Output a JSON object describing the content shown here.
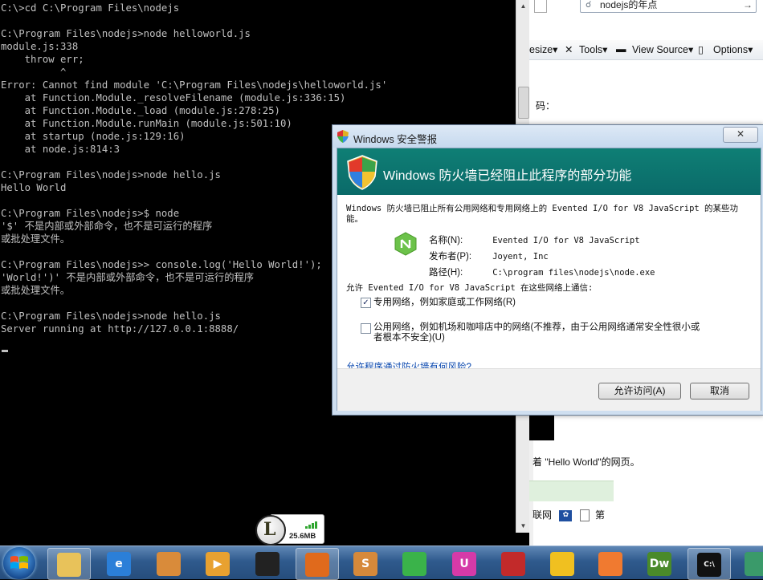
{
  "console": {
    "lines": [
      "C:\\>cd C:\\Program Files\\nodejs",
      "",
      "C:\\Program Files\\nodejs>node helloworld.js",
      "module.js:338",
      "    throw err;",
      "          ^",
      "Error: Cannot find module 'C:\\Program Files\\nodejs\\helloworld.js'",
      "    at Function.Module._resolveFilename (module.js:336:15)",
      "    at Function.Module._load (module.js:278:25)",
      "    at Function.Module.runMain (module.js:501:10)",
      "    at startup (node.js:129:16)",
      "    at node.js:814:3",
      "",
      "C:\\Program Files\\nodejs>node hello.js",
      "Hello World",
      "",
      "C:\\Program Files\\nodejs>$ node",
      "'$' 不是内部或外部命令，也不是可运行的程序",
      "或批处理文件。",
      "",
      "C:\\Program Files\\nodejs>> console.log('Hello World!');",
      "'World!')' 不是内部或外部命令，也不是可运行的程序",
      "或批处理文件。",
      "",
      "C:\\Program Files\\nodejs>node hello.js",
      "Server running at http://127.0.0.1:8888/"
    ]
  },
  "browser": {
    "search_query": "nodejs的年点",
    "toolbar": {
      "resize_label": "esize▾",
      "tools_label": "Tools▾",
      "view_source_label": "View Source▾",
      "options_label": "Options▾"
    },
    "code_label": "码：",
    "hello_text": "着 \"Hello World\"的网页。",
    "bottom_left": "联网",
    "bottom_right": "第"
  },
  "dialog": {
    "title": "Windows 安全警报",
    "close_label": "✕",
    "header": "Windows 防火墙已经阻止此程序的部分功能",
    "description": "Windows 防火墙已阻止所有公用网络和专用网络上的 Evented I/O for V8 JavaScript 的某些功能。",
    "name_label": "名称(N):",
    "name_value": "Evented I/O for V8 JavaScript",
    "publisher_label": "发布者(P):",
    "publisher_value": "Joyent, Inc",
    "path_label": "路径(H):",
    "path_value": "C:\\program files\\nodejs\\node.exe",
    "allow_text": "允许 Evented I/O for V8 JavaScript 在这些网络上通信:",
    "private_label": "专用网络，例如家庭或工作网络(R)",
    "private_checked": true,
    "public_label_1": "公用网络，例如机场和咖啡店中的网络(不推荐，由于公用网络通常安全性很小或",
    "public_label_2": "者根本不安全)(U)",
    "public_checked": false,
    "risk_link": "允许程序通过防火墙有何风险?",
    "allow_button": "允许访问(A)",
    "cancel_button": "取消"
  },
  "memory_widget": {
    "value": "25.6MB",
    "logo_letter": "L"
  },
  "taskbar": {
    "items": [
      {
        "name": "explorer",
        "color": "#e8c25a",
        "label": ""
      },
      {
        "name": "ie",
        "color": "#2b7fd8",
        "label": "e"
      },
      {
        "name": "paint",
        "color": "#d98b3a",
        "label": ""
      },
      {
        "name": "media",
        "color": "#e8a130",
        "label": "▶"
      },
      {
        "name": "qq",
        "color": "#222222",
        "label": ""
      },
      {
        "name": "firefox",
        "color": "#e06a1c",
        "label": ""
      },
      {
        "name": "sublime",
        "color": "#d6893a",
        "label": "S"
      },
      {
        "name": "green-app",
        "color": "#3ab34a",
        "label": ""
      },
      {
        "name": "magenta-app",
        "color": "#d63aa8",
        "label": "U"
      },
      {
        "name": "red-app",
        "color": "#c22a2a",
        "label": ""
      },
      {
        "name": "yellow-app",
        "color": "#f0c020",
        "label": ""
      },
      {
        "name": "fox-app",
        "color": "#f07a30",
        "label": ""
      },
      {
        "name": "dreamweaver",
        "color": "#4a8a2a",
        "label": "Dw"
      },
      {
        "name": "cmd",
        "color": "#111111",
        "label": "C:\\"
      },
      {
        "name": "last-app",
        "color": "#3a9a6a",
        "label": ""
      }
    ]
  },
  "colors": {
    "console_text": "#c0c0c0",
    "dialog_header": "#0f7f75",
    "link": "#0645ad"
  }
}
